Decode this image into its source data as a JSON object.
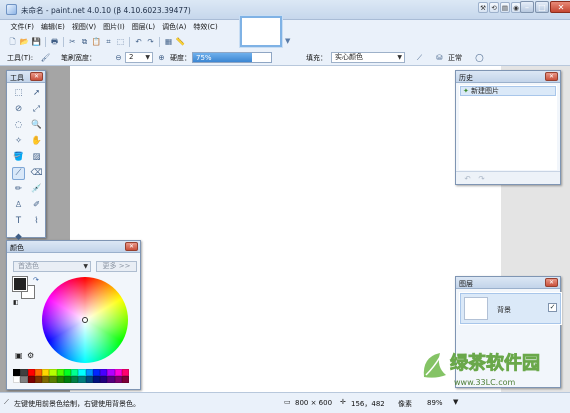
{
  "window": {
    "title": "未命名 - paint.net 4.0.10 (β 4.10.6023.39477)"
  },
  "menu": [
    "文件(F)",
    "编辑(E)",
    "视图(V)",
    "图片(I)",
    "图层(L)",
    "调色(A)",
    "特效(C)"
  ],
  "options": {
    "tool_label": "工具(T):",
    "brush_width_label": "笔刷宽度：",
    "brush_width_value": "2",
    "hardness_label": "硬度：",
    "hardness_value": "75%",
    "hardness_fraction": 0.75,
    "fill_label": "填充：",
    "fill_value": "实心颜色",
    "blend_mode": "正常"
  },
  "panels": {
    "tools": {
      "title": "工具"
    },
    "history": {
      "title": "历史",
      "items": [
        "新建图片"
      ]
    },
    "layers": {
      "title": "图层",
      "items": [
        {
          "name": "背景",
          "visible": true
        }
      ]
    },
    "colors": {
      "title": "颜色",
      "mode_value": "首选色",
      "more_label": "更多 >>",
      "primary": "#222222",
      "secondary": "#ffffff"
    }
  },
  "palette": [
    "#000000",
    "#404040",
    "#ff0000",
    "#ff6a00",
    "#ffd800",
    "#b6ff00",
    "#4cff00",
    "#00ff21",
    "#00ff90",
    "#00ffff",
    "#0094ff",
    "#0026ff",
    "#4800ff",
    "#b200ff",
    "#ff00dc",
    "#ff006e",
    "#ffffff",
    "#808080",
    "#7f0000",
    "#7f3300",
    "#7f6a00",
    "#5b7f00",
    "#267f00",
    "#007f0e",
    "#007f46",
    "#007f7f",
    "#004a7f",
    "#00137f",
    "#21007f",
    "#57007f",
    "#7f006e",
    "#7f0037"
  ],
  "status": {
    "hint": "左键使用前景色绘制，右键使用背景色。",
    "image_size": "800 × 600",
    "cursor_pos": "156，482",
    "units": "像素",
    "zoom": "89%"
  },
  "watermark": {
    "text": "绿茶软件园",
    "url": "www.33LC.com"
  }
}
